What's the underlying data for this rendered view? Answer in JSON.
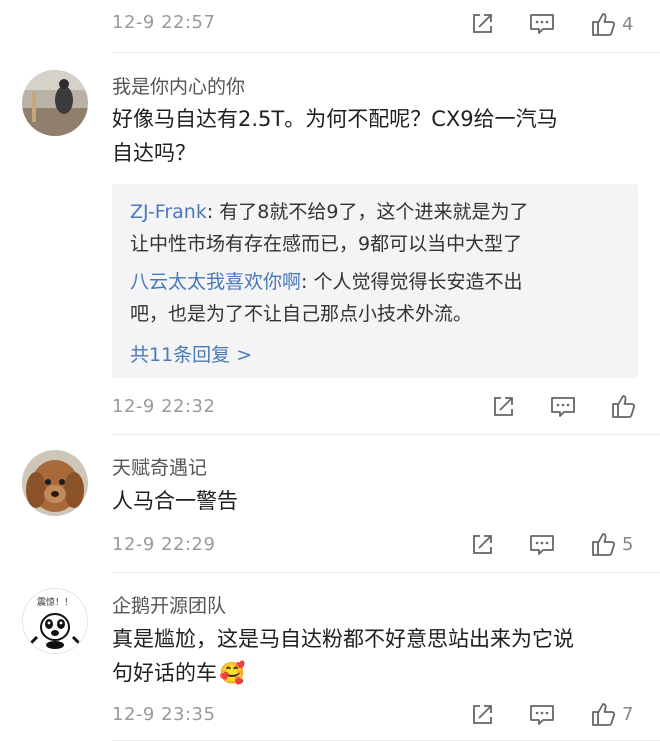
{
  "comments": [
    {
      "timestamp": "12-9 22:57",
      "like_count": "4"
    },
    {
      "username": "我是你内心的你",
      "text_line1": "好像马自达有2.5T。为何不配呢？CX9给一汽马",
      "text_line2": "自达吗？",
      "replies": [
        {
          "user": "ZJ-Frank",
          "line1": ": 有了8就不给9了，这个进来就是为了",
          "line2": "让中性市场有存在感而已，9都可以当中大型了"
        },
        {
          "user": "八云太太我喜欢你啊",
          "line1": ": 个人觉得觉得长安造不出",
          "line2": "吧，也是为了不让自己那点小技术外流。"
        }
      ],
      "more_replies": "共11条回复 >",
      "timestamp": "12-9 22:32"
    },
    {
      "username": "天赋奇遇记",
      "text_line1": "人马合一警告",
      "timestamp": "12-9 22:29",
      "like_count": "5"
    },
    {
      "username": "企鹅开源团队",
      "avatar_text": "震惊！！",
      "text_line1": "真是尴尬，这是马自达粉都不好意思站出来为它说",
      "text_line2": "句好话的车",
      "emoji": "🥰",
      "timestamp": "12-9 23:35",
      "like_count": "7"
    }
  ],
  "icons": {
    "share": "share-icon",
    "comment": "comment-icon",
    "like": "thumbs-up-icon"
  },
  "colors": {
    "link_blue": "#4a79b7",
    "timestamp_gray": "#9a9a9a",
    "reply_bg": "#f4f4f6"
  }
}
